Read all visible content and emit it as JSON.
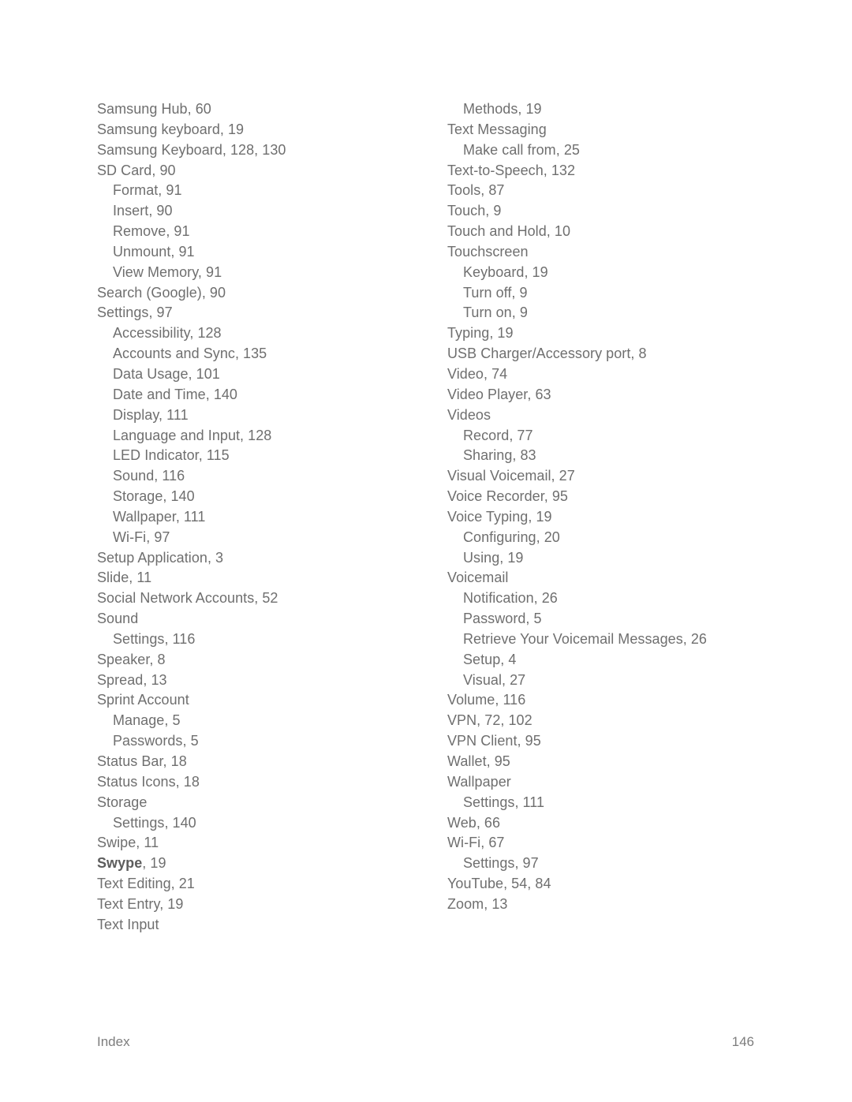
{
  "document": {
    "footer": {
      "section_label": "Index",
      "page_number": "146"
    },
    "text_color": "#6f6f6f",
    "background_color": "#ffffff"
  },
  "index": {
    "columns": [
      {
        "name": "left-column",
        "entries": [
          {
            "text": "Samsung Hub, 60",
            "level": 0
          },
          {
            "text": "Samsung keyboard, 19",
            "level": 0
          },
          {
            "text": "Samsung Keyboard, 128, 130",
            "level": 0
          },
          {
            "text": "SD Card, 90",
            "level": 0
          },
          {
            "text": "Format, 91",
            "level": 1
          },
          {
            "text": "Insert, 90",
            "level": 1
          },
          {
            "text": "Remove, 91",
            "level": 1
          },
          {
            "text": "Unmount, 91",
            "level": 1
          },
          {
            "text": "View Memory, 91",
            "level": 1
          },
          {
            "text": "Search (Google), 90",
            "level": 0
          },
          {
            "text": "Settings, 97",
            "level": 0
          },
          {
            "text": "Accessibility, 128",
            "level": 1
          },
          {
            "text": "Accounts and Sync, 135",
            "level": 1
          },
          {
            "text": "Data Usage, 101",
            "level": 1
          },
          {
            "text": "Date and Time, 140",
            "level": 1
          },
          {
            "text": "Display, 111",
            "level": 1
          },
          {
            "text": "Language and Input, 128",
            "level": 1
          },
          {
            "text": "LED Indicator, 115",
            "level": 1
          },
          {
            "text": "Sound, 116",
            "level": 1
          },
          {
            "text": "Storage, 140",
            "level": 1
          },
          {
            "text": "Wallpaper, 111",
            "level": 1
          },
          {
            "text": "Wi-Fi, 97",
            "level": 1
          },
          {
            "text": "Setup Application, 3",
            "level": 0
          },
          {
            "text": "Slide, 11",
            "level": 0
          },
          {
            "text": "Social Network Accounts, 52",
            "level": 0
          },
          {
            "text": "Sound",
            "level": 0
          },
          {
            "text": "Settings, 116",
            "level": 1
          },
          {
            "text": "Speaker, 8",
            "level": 0
          },
          {
            "text": "Spread, 13",
            "level": 0
          },
          {
            "text": "Sprint Account",
            "level": 0
          },
          {
            "text": "Manage, 5",
            "level": 1
          },
          {
            "text": "Passwords, 5",
            "level": 1
          },
          {
            "text": "Status Bar, 18",
            "level": 0
          },
          {
            "text": "Status Icons, 18",
            "level": 0
          },
          {
            "text": "Storage",
            "level": 0
          },
          {
            "text": "Settings, 140",
            "level": 1
          },
          {
            "text": "Swipe, 11",
            "level": 0
          },
          {
            "text": "Swype, 19",
            "level": 0,
            "bold_term": "Swype",
            "rest": ", 19"
          },
          {
            "text": "Text Editing, 21",
            "level": 0
          },
          {
            "text": "Text Entry, 19",
            "level": 0
          },
          {
            "text": "Text Input",
            "level": 0
          }
        ]
      },
      {
        "name": "right-column",
        "entries": [
          {
            "text": "Methods, 19",
            "level": 1
          },
          {
            "text": "Text Messaging",
            "level": 0
          },
          {
            "text": "Make call from, 25",
            "level": 1
          },
          {
            "text": "Text-to-Speech, 132",
            "level": 0
          },
          {
            "text": "Tools, 87",
            "level": 0
          },
          {
            "text": "Touch, 9",
            "level": 0
          },
          {
            "text": "Touch and Hold, 10",
            "level": 0
          },
          {
            "text": "Touchscreen",
            "level": 0
          },
          {
            "text": "Keyboard, 19",
            "level": 1
          },
          {
            "text": "Turn off, 9",
            "level": 1
          },
          {
            "text": "Turn on, 9",
            "level": 1
          },
          {
            "text": "Typing, 19",
            "level": 0
          },
          {
            "text": "USB Charger/Accessory port, 8",
            "level": 0
          },
          {
            "text": "Video, 74",
            "level": 0
          },
          {
            "text": "Video Player, 63",
            "level": 0
          },
          {
            "text": "Videos",
            "level": 0
          },
          {
            "text": "Record, 77",
            "level": 1
          },
          {
            "text": "Sharing, 83",
            "level": 1
          },
          {
            "text": "Visual Voicemail, 27",
            "level": 0
          },
          {
            "text": "Voice Recorder, 95",
            "level": 0
          },
          {
            "text": "Voice Typing, 19",
            "level": 0
          },
          {
            "text": "Configuring, 20",
            "level": 1
          },
          {
            "text": "Using, 19",
            "level": 1
          },
          {
            "text": "Voicemail",
            "level": 0
          },
          {
            "text": "Notification, 26",
            "level": 1
          },
          {
            "text": "Password, 5",
            "level": 1
          },
          {
            "text": "Retrieve Your Voicemail Messages, 26",
            "level": 1
          },
          {
            "text": "Setup, 4",
            "level": 1
          },
          {
            "text": "Visual, 27",
            "level": 1
          },
          {
            "text": "Volume, 116",
            "level": 0
          },
          {
            "text": "VPN, 72, 102",
            "level": 0
          },
          {
            "text": "VPN Client, 95",
            "level": 0
          },
          {
            "text": "Wallet, 95",
            "level": 0
          },
          {
            "text": "Wallpaper",
            "level": 0
          },
          {
            "text": "Settings, 111",
            "level": 1
          },
          {
            "text": "Web, 66",
            "level": 0
          },
          {
            "text": "Wi-Fi, 67",
            "level": 0
          },
          {
            "text": "Settings, 97",
            "level": 1
          },
          {
            "text": "YouTube, 54, 84",
            "level": 0
          },
          {
            "text": "Zoom, 13",
            "level": 0
          }
        ]
      }
    ]
  }
}
